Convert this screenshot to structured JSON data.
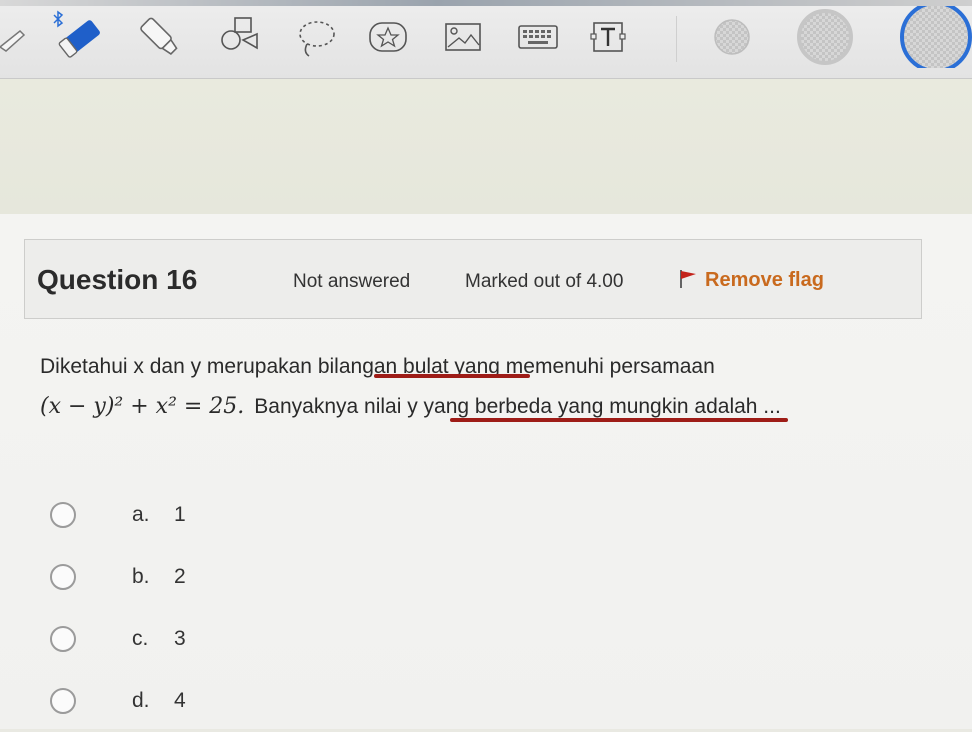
{
  "question": {
    "title": "Question 16",
    "state": "Not answered",
    "marks": "Marked out of 4.00",
    "flag_label": "Remove flag",
    "text_line1": "Diketahui x dan y merupakan bilangan bulat yang memenuhi persamaan",
    "math_equation": "(x − y)² + x² = 25.",
    "text_line2": "Banyaknya nilai y yang berbeda yang mungkin adalah ..."
  },
  "options": [
    {
      "letter": "a.",
      "value": "1"
    },
    {
      "letter": "b.",
      "value": "2"
    },
    {
      "letter": "c.",
      "value": "3"
    },
    {
      "letter": "d.",
      "value": "4"
    }
  ],
  "toolbar": {
    "tools": [
      "pen-icon",
      "eraser-icon",
      "highlighter-icon",
      "shapes-icon",
      "lasso-icon",
      "sticker-icon",
      "image-icon",
      "keyboard-icon",
      "text-box-icon",
      "color-swatch-icon"
    ]
  },
  "colors": {
    "flag": "#c96a1e",
    "flag_icon": "#c3241b",
    "underline": "#9e1c17",
    "accent_blue": "#2b6fd6"
  }
}
